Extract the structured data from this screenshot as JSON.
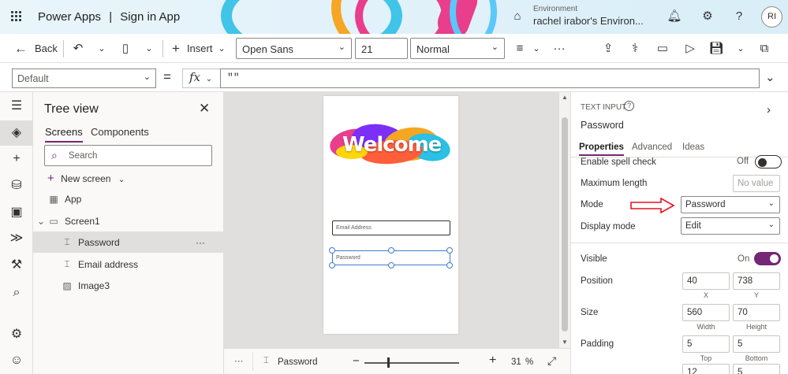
{
  "header": {
    "app_name": "Power Apps",
    "divider": "|",
    "app_title": "Sign in App",
    "environment_label": "Environment",
    "environment_value": "rachel irabor's Environ...",
    "avatar_initials": "RI"
  },
  "toolbar": {
    "back_label": "Back",
    "insert_label": "Insert",
    "font_value": "Open Sans",
    "font_size_value": "21",
    "font_weight_value": "Normal",
    "more_label": "···"
  },
  "formula": {
    "property_value": "Default",
    "equals": "=",
    "fx_label": "fx",
    "expression": "\"\""
  },
  "tree": {
    "title": "Tree view",
    "tabs": [
      "Screens",
      "Components"
    ],
    "search_placeholder": "Search",
    "new_screen_label": "New screen",
    "items": [
      {
        "label": "App"
      },
      {
        "label": "Screen1"
      },
      {
        "label": "Password"
      },
      {
        "label": "Email address"
      },
      {
        "label": "Image3"
      }
    ],
    "item_more": "···"
  },
  "canvas": {
    "welcome_text": "Welcome",
    "email_placeholder": "Email Address",
    "password_placeholder": "Password"
  },
  "status": {
    "more": "···",
    "selected_control": "Password",
    "zoom_minus": "−",
    "zoom_plus": "+",
    "zoom_value": "31",
    "zoom_unit": "%"
  },
  "properties": {
    "control_type": "TEXT INPUT",
    "control_name": "Password",
    "tabs": [
      "Properties",
      "Advanced",
      "Ideas"
    ],
    "enable_spell_check_label": "Enable spell check",
    "enable_spell_check_value": "Off",
    "max_length_label": "Maximum length",
    "max_length_placeholder": "No value",
    "mode_label": "Mode",
    "mode_value": "Password",
    "display_mode_label": "Display mode",
    "display_mode_value": "Edit",
    "visible_label": "Visible",
    "visible_value": "On",
    "position_label": "Position",
    "position_x": "40",
    "position_y": "738",
    "x_label": "X",
    "y_label": "Y",
    "size_label": "Size",
    "size_width": "560",
    "size_height": "70",
    "width_label": "Width",
    "height_label": "Height",
    "padding_label": "Padding",
    "padding_top": "5",
    "padding_bottom": "5",
    "top_label": "Top",
    "bottom_label": "Bottom",
    "padding_left": "12",
    "padding_right": "5"
  },
  "colors": {
    "accent": "#742774",
    "arrow": "#e81123",
    "selection": "#3f7cc9"
  }
}
